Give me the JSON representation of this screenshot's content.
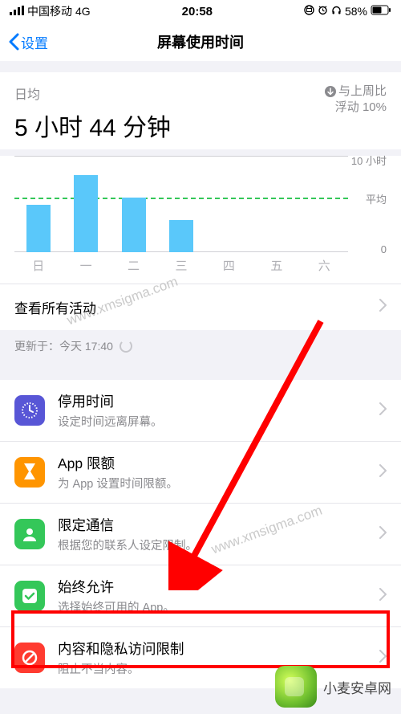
{
  "status": {
    "carrier": "中国移动",
    "network": "4G",
    "time": "20:58",
    "battery": "58%"
  },
  "nav": {
    "back": "设置",
    "title": "屏幕使用时间"
  },
  "summary": {
    "daily_label": "日均",
    "daily_value": "5 小时 44 分钟",
    "compare_line1": "与上周比",
    "compare_line2": "浮动 10%"
  },
  "chart_data": {
    "type": "bar",
    "categories": [
      "日",
      "一",
      "二",
      "三",
      "四",
      "五",
      "六"
    ],
    "values": [
      4.9,
      8.0,
      5.7,
      3.3,
      0,
      0,
      0
    ],
    "title": "",
    "xlabel": "",
    "ylabel": "",
    "ylim": [
      0,
      10
    ],
    "y_top_label": "10 小时",
    "y_bottom_label": "0",
    "avg_value": 5.7,
    "avg_label": "平均"
  },
  "see_all": "查看所有活动",
  "updated": "更新于：今天 17:40",
  "settings": [
    {
      "id": "downtime",
      "title": "停用时间",
      "sub": "设定时间远离屏幕。",
      "color": "#5856d6"
    },
    {
      "id": "app-limits",
      "title": "App 限额",
      "sub": "为 App 设置时间限额。",
      "color": "#ff9500"
    },
    {
      "id": "communication",
      "title": "限定通信",
      "sub": "根据您的联系人设定限制。",
      "color": "#34c759"
    },
    {
      "id": "always-allowed",
      "title": "始终允许",
      "sub": "选择始终可用的 App。",
      "color": "#34c759"
    },
    {
      "id": "content-privacy",
      "title": "内容和隐私访问限制",
      "sub": "阻止不当内容。",
      "color": "#ff3b30"
    }
  ],
  "watermark": "www.xmsigma.com",
  "brand": "小麦安卓网"
}
